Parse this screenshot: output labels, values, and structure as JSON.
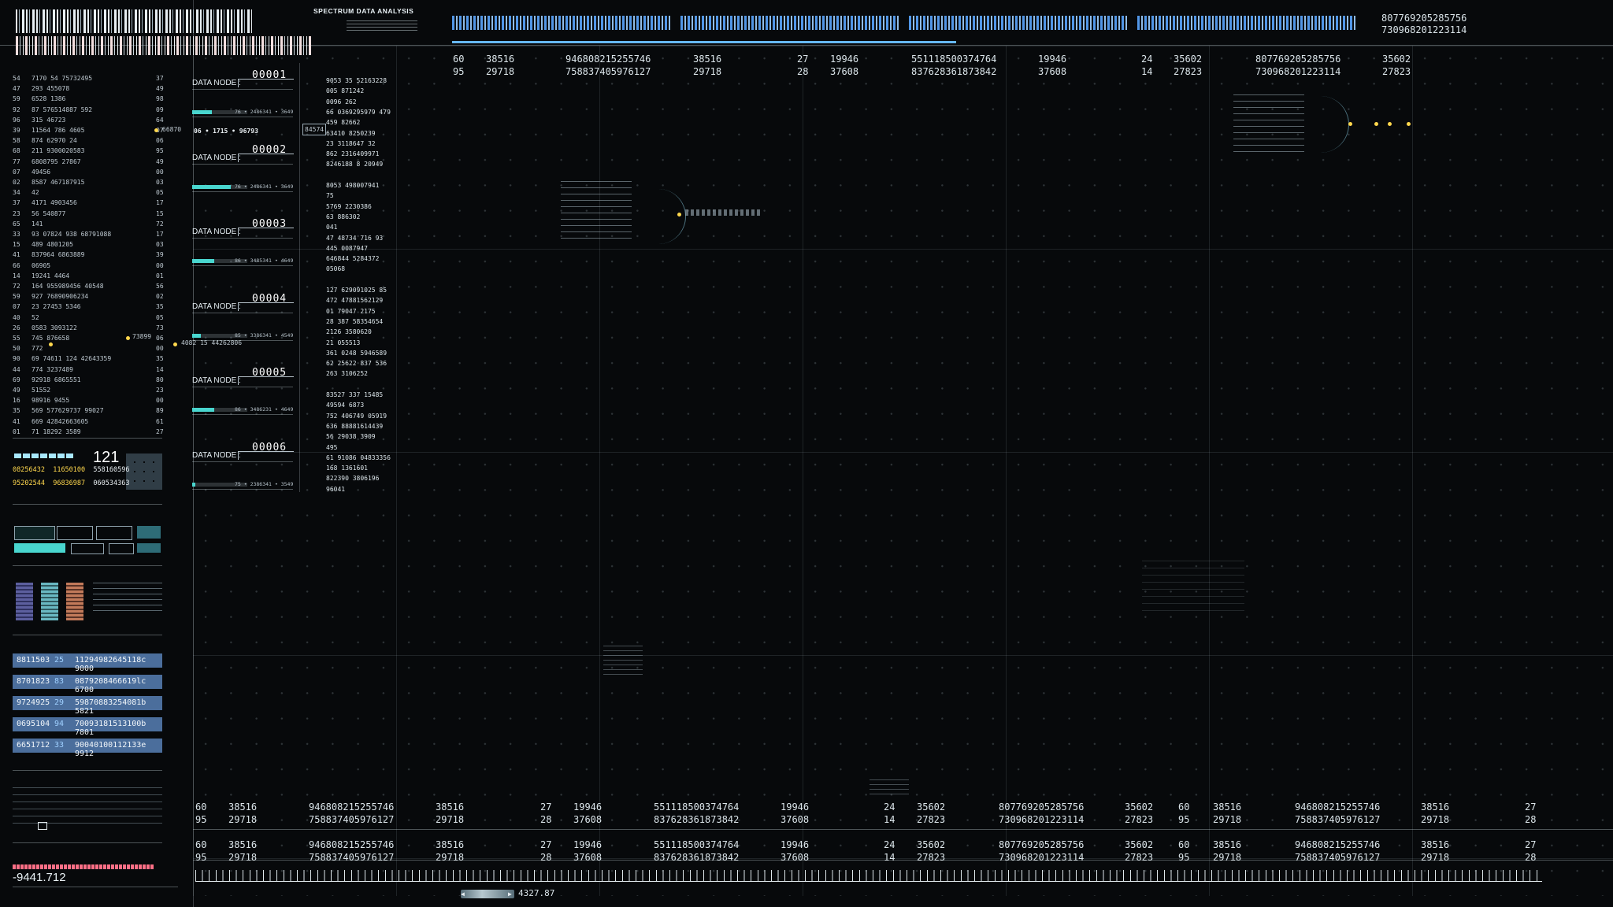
{
  "header": {
    "title": "SPECTRUM DATA ANALYSIS",
    "top_right_a": "807769205285756",
    "top_right_b": "730968201223114",
    "hud_rows": [
      {
        "a": "60",
        "b": "38516",
        "c": "946808215255746",
        "d": "38516",
        "e": "27",
        "f": "19946",
        "g": "551118500374764",
        "h": "19946",
        "i": "24",
        "j": "35602",
        "k": "807769205285756",
        "l": "35602"
      },
      {
        "a": "95",
        "b": "29718",
        "c": "758837405976127",
        "d": "29718",
        "e": "28",
        "f": "37608",
        "g": "837628361873842",
        "h": "37608",
        "i": "14",
        "j": "27823",
        "k": "730968201223114",
        "l": "27823"
      }
    ]
  },
  "left_column": {
    "rows": [
      [
        "54",
        "7170 54 75732495",
        "37"
      ],
      [
        "47",
        "293 455078",
        "49"
      ],
      [
        "59",
        "6528 1386",
        "98"
      ],
      [
        "92",
        "87 576514887 592",
        "09"
      ],
      [
        "96",
        "315 46723",
        "64"
      ],
      [
        "39",
        "11564 786 4605",
        "07"
      ],
      [
        "58",
        "874 62970 24",
        "06"
      ],
      [
        "68",
        "211 9300020583",
        "95"
      ],
      [
        "77",
        "6808795 27867",
        "49"
      ],
      [
        "07",
        "49456",
        "00"
      ],
      [
        "02",
        "8587 467187915",
        "03"
      ],
      [
        "34",
        "42",
        "05"
      ],
      [
        "37",
        "4171 4903456",
        "17"
      ],
      [
        "23",
        "56 540877",
        "15"
      ],
      [
        "65",
        "141",
        "72"
      ],
      [
        "33",
        "93 07824 938 68791088",
        "17"
      ],
      [
        "15",
        "489 4801205",
        "03"
      ],
      [
        "41",
        "837964 6863889",
        "39"
      ],
      [
        "66",
        "06905",
        "00"
      ],
      [
        "14",
        "19241 4464",
        "01"
      ],
      [
        "72",
        "164 955989456 40548",
        "56"
      ],
      [
        "59",
        "927 76890906234",
        "02"
      ],
      [
        "07",
        "23 27453 5346",
        "35"
      ],
      [
        "40",
        "52",
        "05"
      ],
      [
        "26",
        "0583 3093122",
        "73"
      ],
      [
        "55",
        "745 876658",
        "06"
      ],
      [
        "50",
        "772",
        "00"
      ],
      [
        "90",
        "69 74611 124 42643359",
        "35"
      ],
      [
        "44",
        "774 3237489",
        "14"
      ],
      [
        "69",
        "92918 6865551",
        "80"
      ],
      [
        "49",
        "51552",
        "23"
      ],
      [
        "16",
        "98916 9455",
        "00"
      ],
      [
        "35",
        "569 577629737 99027",
        "89"
      ],
      [
        "41",
        "669 42842663605",
        "61"
      ],
      [
        "01",
        "71 18292 3589",
        "27"
      ]
    ],
    "callout_a": "66870",
    "callout_b": "73899",
    "callout_c": "4082 15 44262806",
    "big_number": "121",
    "yellow_a": "08256432",
    "yellow_b": "11650100",
    "yellow_c": "558160596",
    "yellow_d": "95202544",
    "yellow_e": "96836987",
    "yellow_f": "060534363",
    "table": [
      {
        "a": "8811503",
        "b": "25",
        "c": "11294982645118c 9000"
      },
      {
        "a": "8701823",
        "b": "83",
        "c": "0879208466619lc 6700"
      },
      {
        "a": "9724925",
        "b": "29",
        "c": "59870883254081b 5821"
      },
      {
        "a": "0695104",
        "b": "94",
        "c": "70093181513100b 7801"
      },
      {
        "a": "6651712",
        "b": "33",
        "c": "90040100112133e 9912"
      }
    ],
    "readout": "-9441.712"
  },
  "nodes": [
    {
      "label": "DATA NODE :",
      "id": "00001",
      "stat": "76 • 2486341 • 3649",
      "fill": 0.35
    },
    {
      "label": "DATA NODE :",
      "id": "00002",
      "stat": "76 • 2486341 • 3649",
      "fill": 0.7
    },
    {
      "label": "DATA NODE :",
      "id": "00003",
      "stat": "86 • 3485341 • 4649",
      "fill": 0.4
    },
    {
      "label": "DATA NODE :",
      "id": "00004",
      "stat": "85 • 3386341 • 4549",
      "fill": 0.15
    },
    {
      "label": "DATA NODE :",
      "id": "00005",
      "stat": "86 • 3486231 • 4649",
      "fill": 0.4
    },
    {
      "label": "DATA NODE :",
      "id": "00006",
      "stat": "75 • 2386341 • 3549",
      "fill": 0.05
    }
  ],
  "node_extras": {
    "tag_a": "06 • 1715 • 96793",
    "tag_b": "84574"
  },
  "number_list": [
    "9053 35 52163228",
    "005 871242",
    "0096 262",
    "66 0369295979 479",
    "459 82662",
    "63410 8250239",
    "23 3118647 32",
    "862 2316409971",
    "8246188 8 20949",
    "",
    "8053 498007941",
    "75",
    "5769 2230386",
    "63 886302",
    "041",
    "47 48734 716 93",
    "445 0087947",
    "646844 5284372",
    "05068",
    "",
    "127 629091025 85",
    "472 47881562129",
    "01 79047 2175",
    "28 387 58354654",
    "2126 3580620",
    "21 055513",
    "361 0248 5946589",
    "62 25622 837 536",
    "263 3106252",
    "",
    "83527 337 15485",
    "49594 6873",
    "752 406749 05919",
    "636 88881614439",
    "56 29038 3909",
    "495",
    "61 91086 04833356",
    "168 1361601",
    "822390 3806196",
    "96041"
  ],
  "bottom": {
    "rows": [
      {
        "a": "60",
        "b": "38516",
        "c": "946808215255746",
        "d": "38516",
        "e": "27",
        "f": "19946",
        "g": "551118500374764",
        "h": "19946",
        "i": "24",
        "j": "35602",
        "k": "807769205285756",
        "l": "35602",
        "m": "60",
        "n": "38516",
        "o": "946808215255746",
        "p": "38516",
        "q": "27"
      },
      {
        "a": "95",
        "b": "29718",
        "c": "758837405976127",
        "d": "29718",
        "e": "28",
        "f": "37608",
        "g": "837628361873842",
        "h": "37608",
        "i": "14",
        "j": "27823",
        "k": "730968201223114",
        "l": "27823",
        "m": "95",
        "n": "29718",
        "o": "758837405976127",
        "p": "29718",
        "q": "28"
      },
      {
        "a": "60",
        "b": "38516",
        "c": "946808215255746",
        "d": "38516",
        "e": "27",
        "f": "19946",
        "g": "551118500374764",
        "h": "19946",
        "i": "24",
        "j": "35602",
        "k": "807769205285756",
        "l": "35602",
        "m": "60",
        "n": "38516",
        "o": "946808215255746",
        "p": "38516",
        "q": "27"
      },
      {
        "a": "95",
        "b": "29718",
        "c": "758837405976127",
        "d": "29718",
        "e": "28",
        "f": "37608",
        "g": "837628361873842",
        "h": "37608",
        "i": "14",
        "j": "27823",
        "k": "730968201223114",
        "l": "27823",
        "m": "95",
        "n": "29718",
        "o": "758837405976127",
        "p": "29718",
        "q": "28"
      }
    ],
    "scrub_value": "4327.87"
  },
  "colors": {
    "accent_cyan": "#49d6cf",
    "accent_blue": "#5aa6ff",
    "accent_yellow": "#ffd84d",
    "panel_blue": "#4b6e9c"
  }
}
